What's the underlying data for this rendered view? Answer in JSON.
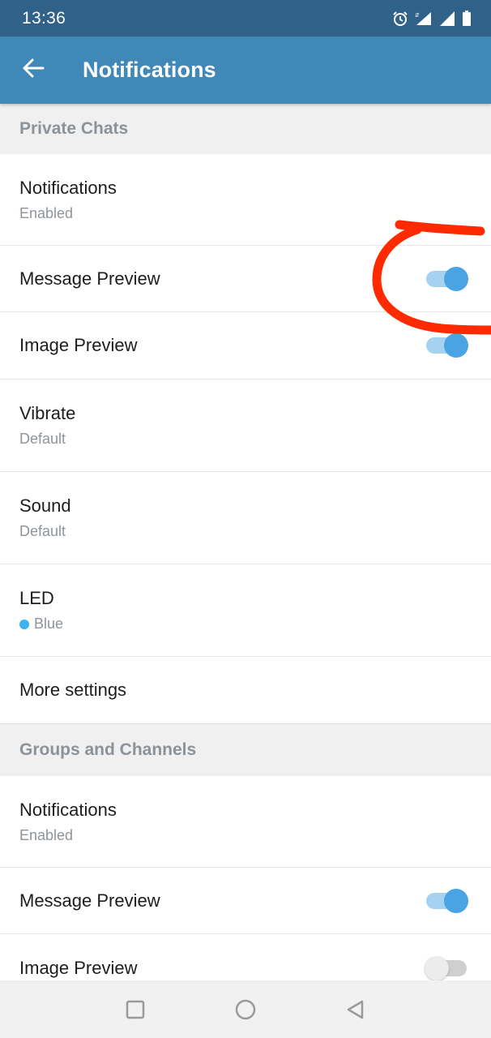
{
  "status_bar": {
    "time": "13:36",
    "icons": [
      "alarm-icon",
      "data-activity-icon",
      "signal-icon",
      "signal-icon",
      "battery-icon"
    ]
  },
  "app_bar": {
    "title": "Notifications",
    "back_icon": "arrow-left-icon"
  },
  "sections": [
    {
      "header": "Private Chats",
      "rows": [
        {
          "label": "Notifications",
          "sub": "Enabled"
        },
        {
          "label": "Message Preview",
          "toggle": true
        },
        {
          "label": "Image Preview",
          "toggle": true
        },
        {
          "label": "Vibrate",
          "sub": "Default"
        },
        {
          "label": "Sound",
          "sub": "Default"
        },
        {
          "label": "LED",
          "sub": "Blue",
          "sub_color": "#3ab3ef"
        },
        {
          "label": "More settings"
        }
      ]
    },
    {
      "header": "Groups and Channels",
      "rows": [
        {
          "label": "Notifications",
          "sub": "Enabled"
        },
        {
          "label": "Message Preview",
          "toggle": true
        },
        {
          "label": "Image Preview",
          "toggle": false
        }
      ]
    }
  ],
  "nav_bar": {
    "buttons": [
      "recents-square-icon",
      "home-circle-icon",
      "back-triangle-icon"
    ]
  },
  "colors": {
    "status_bar": "#2f6189",
    "app_bar": "#3f88b8",
    "toggle_on_thumb": "#4aa3e3",
    "toggle_on_track": "#a6d2f1",
    "annotation": "#ff2a00"
  }
}
